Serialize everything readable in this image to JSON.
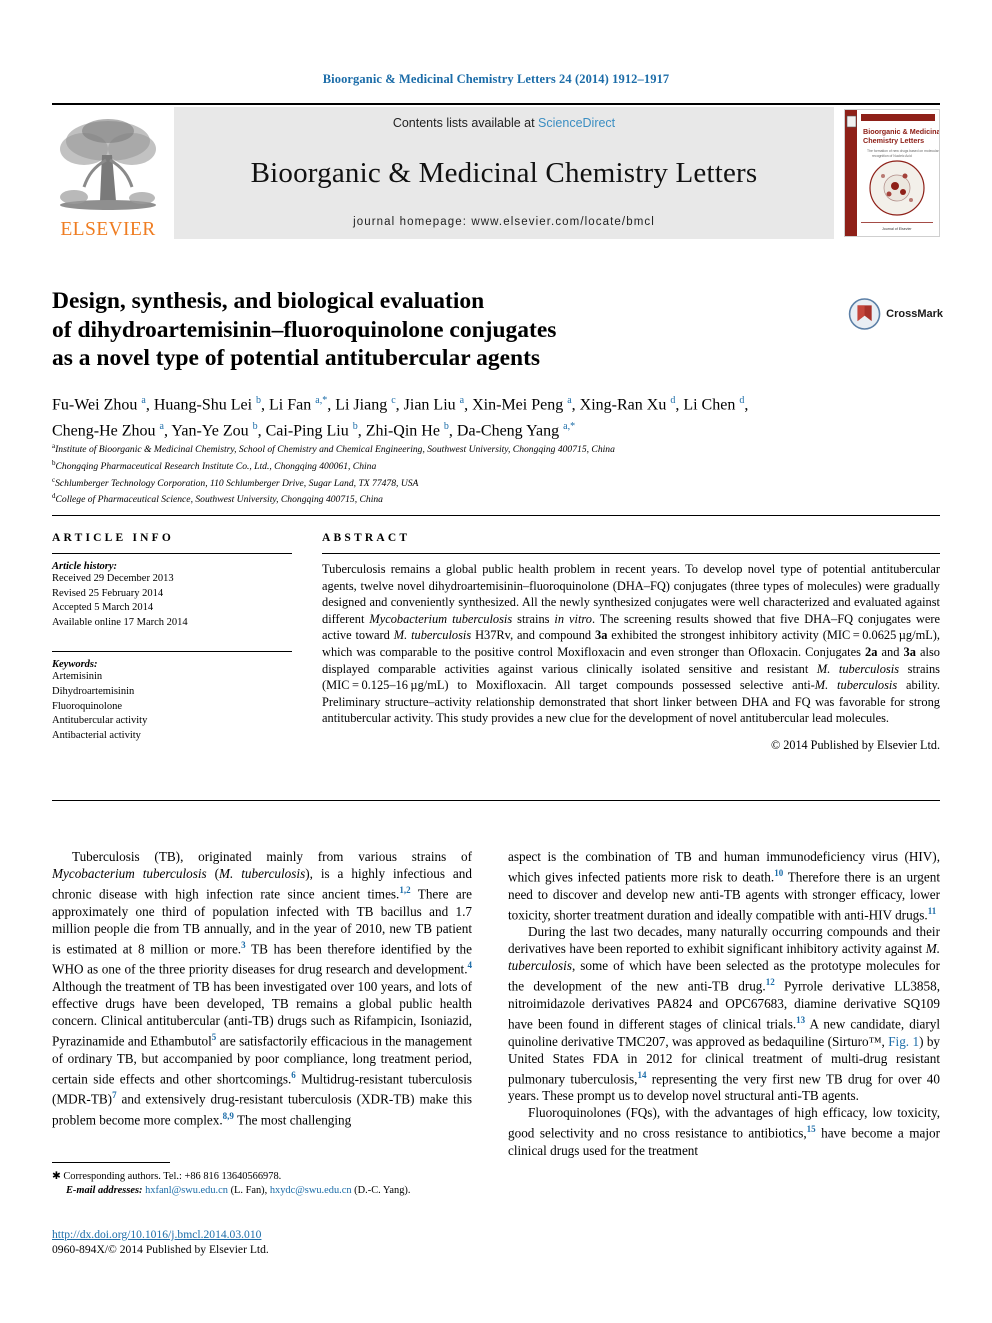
{
  "running_head": "Bioorganic & Medicinal Chemistry Letters 24 (2014) 1912–1917",
  "masthead": {
    "contents_prefix": "Contents lists available at ",
    "sciencedirect": "ScienceDirect",
    "journal_name": "Bioorganic & Medicinal Chemistry Letters",
    "homepage": "journal homepage: www.elsevier.com/locate/bmcl",
    "publisher_word": "ELSEVIER",
    "cover": {
      "title_line1": "Bioorganic & Medicinal",
      "title_line2": "Chemistry Letters",
      "subtitle": "The formation of new drugs based on molecular recognition of Nucleic Acid/Protein",
      "footer": "Journal of Elsevier"
    }
  },
  "article": {
    "title_line1": "Design, synthesis, and biological evaluation",
    "title_line2": "of dihydroartemisinin–fluoroquinolone conjugates",
    "title_line3": "as a novel type of potential antitubercular agents",
    "crossmark_label": "CrossMark",
    "authors_line1": "Fu-Wei Zhou a, Huang-Shu Lei b, Li Fan a,*, Li Jiang c, Jian Liu a, Xin-Mei Peng a, Xing-Ran Xu d, Li Chen d,",
    "authors_line2": "Cheng-He Zhou a, Yan-Ye Zou b, Cai-Ping Liu b, Zhi-Qin He b, Da-Cheng Yang a,*",
    "affiliations": [
      "Institute of Bioorganic & Medicinal Chemistry, School of Chemistry and Chemical Engineering, Southwest University, Chongqing 400715, China",
      "Chongqing Pharmaceutical Research Institute Co., Ltd., Chongqing 400061, China",
      "Schlumberger Technology Corporation, 110 Schlumberger Drive, Sugar Land, TX 77478, USA",
      "College of Pharmaceutical Science, Southwest University, Chongqing 400715, China"
    ],
    "affiliation_markers": [
      "a",
      "b",
      "c",
      "d"
    ]
  },
  "article_info": {
    "heading": "ARTICLE INFO",
    "history_label": "Article history:",
    "history": [
      "Received 29 December 2013",
      "Revised 25 February 2014",
      "Accepted 5 March 2014",
      "Available online 17 March 2014"
    ],
    "keywords_label": "Keywords:",
    "keywords": [
      "Artemisinin",
      "Dihydroartemisinin",
      "Fluoroquinolone",
      "Antitubercular activity",
      "Antibacterial activity"
    ]
  },
  "abstract": {
    "heading": "ABSTRACT",
    "text": "Tuberculosis remains a global public health problem in recent years. To develop novel type of potential antitubercular agents, twelve novel dihydroartemisinin–fluoroquinolone (DHA–FQ) conjugates (three types of molecules) were gradually designed and conveniently synthesized. All the newly synthesized conjugates were well characterized and evaluated against different Mycobacterium tuberculosis strains in vitro. The screening results showed that five DHA–FQ conjugates were active toward M. tuberculosis H37Rv, and compound 3a exhibited the strongest inhibitory activity (MIC = 0.0625 µg/mL), which was comparable to the positive control Moxifloxacin and even stronger than Ofloxacin. Conjugates 2a and 3a also displayed comparable activities against various clinically isolated sensitive and resistant M. tuberculosis strains (MIC = 0.125–16 µg/mL) to Moxifloxacin. All target compounds possessed selective anti-M. tuberculosis ability. Preliminary structure–activity relationship demonstrated that short linker between DHA and FQ was favorable for strong antitubercular activity. This study provides a new clue for the development of novel antitubercular lead molecules.",
    "copyright": "© 2014 Published by Elsevier Ltd."
  },
  "body": {
    "left_paragraph_1": "Tuberculosis (TB), originated mainly from various strains of Mycobacterium tuberculosis (M. tuberculosis), is a highly infectious and chronic disease with high infection rate since ancient times.1,2 There are approximately one third of population infected with TB bacillus and 1.7 million people die from TB annually, and in the year of 2010, new TB patient is estimated at 8 million or more.3 TB has been therefore identified by the WHO as one of the three priority diseases for drug research and development.4 Although the treatment of TB has been investigated over 100 years, and lots of effective drugs have been developed, TB remains a global public health concern. Clinical antitubercular (anti-TB) drugs such as Rifampicin, Isoniazid, Pyrazinamide and Ethambutol5 are satisfactorily efficacious in the management of ordinary TB, but accompanied by poor compliance, long treatment period, certain side effects and other shortcomings.6 Multidrug-resistant tuberculosis (MDR-TB)7 and extensively drug-resistant tuberculosis (XDR-TB) make this problem become more complex.8,9 The most challenging",
    "right_paragraph_1": "aspect is the combination of TB and human immunodeficiency virus (HIV), which gives infected patients more risk to death.10 Therefore there is an urgent need to discover and develop new anti-TB agents with stronger efficacy, lower toxicity, shorter treatment duration and ideally compatible with anti-HIV drugs.11",
    "right_paragraph_2": "During the last two decades, many naturally occurring compounds and their derivatives have been reported to exhibit significant inhibitory activity against M. tuberculosis, some of which have been selected as the prototype molecules for the development of the new anti-TB drug.12 Pyrrole derivative LL3858, nitroimidazole derivatives PA824 and OPC67683, diamine derivative SQ109 have been found in different stages of clinical trials.13 A new candidate, diaryl quinoline derivative TMC207, was approved as bedaquiline (Sirturo™, Fig. 1) by United States FDA in 2012 for clinical treatment of multi-drug resistant pulmonary tuberculosis,14 representing the very first new TB drug for over 40 years. These prompt us to develop novel structural anti-TB agents.",
    "right_paragraph_3": "Fluoroquinolones (FQs), with the advantages of high efficacy, low toxicity, good selectivity and no cross resistance to antibiotics,15 have become a major clinical drugs used for the treatment"
  },
  "footnote": {
    "corresponding": "Corresponding authors. Tel.: +86 816 13640566978.",
    "email_label": "E-mail addresses:",
    "email1": "hxfanl@swu.edu.cn",
    "email1_owner": "(L. Fan),",
    "email2": "hxydc@swu.edu.cn",
    "email2_owner": "(D.-C. Yang)."
  },
  "doi": {
    "url": "http://dx.doi.org/10.1016/j.bmcl.2014.03.010",
    "issn_line": "0960-894X/© 2014 Published by Elsevier Ltd."
  },
  "colors": {
    "link_blue": "#1b6ca8",
    "sciencedirect_blue": "#3b8ec2",
    "elsevier_orange": "#ef7d22",
    "masthead_grey": "#e8e8e8",
    "cover_red": "#9b2218"
  }
}
